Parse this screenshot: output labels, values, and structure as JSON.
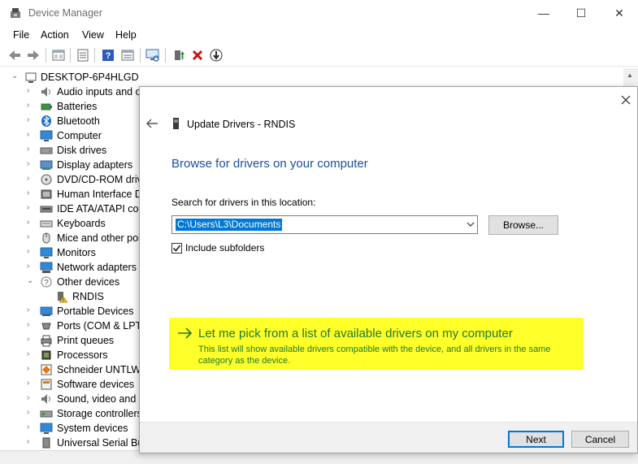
{
  "window": {
    "title": "Device Manager",
    "controls": {
      "minimize": "—",
      "maximize": "☐",
      "close": "✕"
    }
  },
  "menu": {
    "items": [
      "File",
      "Action",
      "View",
      "Help"
    ]
  },
  "tree": {
    "root": "DESKTOP-6P4HLGD",
    "items": [
      {
        "label": "Audio inputs and o",
        "icon": "speaker-icon"
      },
      {
        "label": "Batteries",
        "icon": "battery-icon"
      },
      {
        "label": "Bluetooth",
        "icon": "bluetooth-icon"
      },
      {
        "label": "Computer",
        "icon": "computer-icon"
      },
      {
        "label": "Disk drives",
        "icon": "disk-drive-icon"
      },
      {
        "label": "Display adapters",
        "icon": "display-adapter-icon"
      },
      {
        "label": "DVD/CD-ROM drive",
        "icon": "dvd-icon"
      },
      {
        "label": "Human Interface D",
        "icon": "hid-icon"
      },
      {
        "label": "IDE ATA/ATAPI con",
        "icon": "ide-icon"
      },
      {
        "label": "Keyboards",
        "icon": "keyboard-icon"
      },
      {
        "label": "Mice and other poi",
        "icon": "mouse-icon"
      },
      {
        "label": "Monitors",
        "icon": "monitor-icon"
      },
      {
        "label": "Network adapters",
        "icon": "network-adapter-icon"
      },
      {
        "label": "Other devices",
        "icon": "other-devices-icon"
      },
      {
        "label": "RNDIS",
        "icon": "warning-device-icon"
      },
      {
        "label": "Portable Devices",
        "icon": "portable-device-icon"
      },
      {
        "label": "Ports (COM & LPT)",
        "icon": "port-icon"
      },
      {
        "label": "Print queues",
        "icon": "printer-icon"
      },
      {
        "label": "Processors",
        "icon": "processor-icon"
      },
      {
        "label": "Schneider UNTLW D",
        "icon": "schneider-icon"
      },
      {
        "label": "Software devices",
        "icon": "software-device-icon"
      },
      {
        "label": "Sound, video and g",
        "icon": "sound-icon"
      },
      {
        "label": "Storage controllers",
        "icon": "storage-controller-icon"
      },
      {
        "label": "System devices",
        "icon": "system-device-icon"
      },
      {
        "label": "Universal Serial Bus",
        "icon": "usb-icon"
      }
    ]
  },
  "dialog": {
    "close": "✕",
    "title": "Update Drivers - RNDIS",
    "heading": "Browse for drivers on your computer",
    "search_label": "Search for drivers in this location:",
    "path_value": "C:\\Users\\L3\\Documents",
    "browse_label": "Browse...",
    "include_subfolders_label": "Include subfolders",
    "include_subfolders_checked": true,
    "pick_title": "Let me pick from a list of available drivers on my computer",
    "pick_desc": "This list will show available drivers compatible with the device, and all drivers in the same category as the device.",
    "next_label": "Next",
    "cancel_label": "Cancel"
  },
  "colors": {
    "heading_blue": "#1a4fa0",
    "highlight_yellow": "#ffff2a",
    "link_green": "#1f7a2a",
    "selection_blue": "#0078d7"
  }
}
